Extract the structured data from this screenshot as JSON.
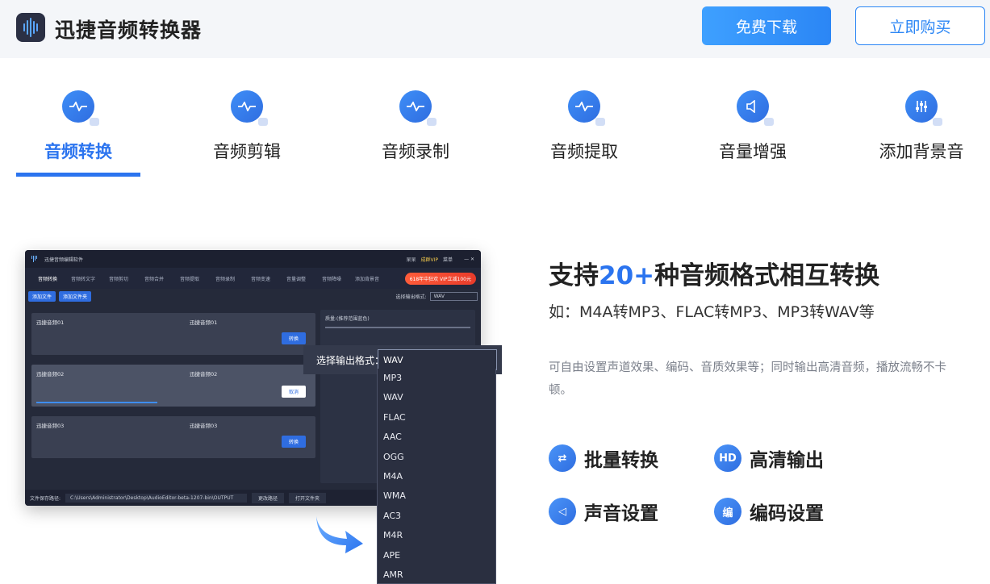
{
  "header": {
    "app_title": "迅捷音频转换器",
    "download_label": "免费下载",
    "buy_label": "立即购买"
  },
  "tabs": [
    {
      "label": "音频转换",
      "active": true
    },
    {
      "label": "音频剪辑",
      "active": false
    },
    {
      "label": "音频录制",
      "active": false
    },
    {
      "label": "音频提取",
      "active": false
    },
    {
      "label": "音量增强",
      "active": false
    },
    {
      "label": "添加背景音",
      "active": false
    }
  ],
  "screenshot": {
    "window_title": "迅捷音频编辑软件",
    "user_name": "呆呆",
    "vip_label": "成群VIP",
    "menu_label": "菜单",
    "tools": [
      "音频转换",
      "音频转文字",
      "音频剪切",
      "音频合并",
      "音频提取",
      "音频录制",
      "音频变速",
      "音量调整",
      "音频降噪",
      "添加背景音"
    ],
    "promo": "618年中狂欢 VIP立减100元",
    "add_file": "添加文件",
    "add_folder": "添加文件夹",
    "output_format_label": "选择输出格式:",
    "output_format_value": "WAV",
    "quality_label": "质量:(推荐范围蓝色)",
    "files": [
      {
        "name": "迅捷音频01",
        "target": "迅捷音频01",
        "action": "转换"
      },
      {
        "name": "迅捷音频02",
        "target": "迅捷音频02",
        "action": "取消"
      },
      {
        "name": "迅捷音频03",
        "target": "迅捷音频03",
        "action": "转换"
      }
    ],
    "save_path_label": "文件保存路径:",
    "save_path": "C:\\Users\\Administrator\\Desktop\\AudioEditor-beta-1207-bin\\OUTPUT",
    "change_path": "更改路径",
    "open_folder": "打开文件夹"
  },
  "format_dropdown": {
    "label": "选择输出格式：",
    "selected": "WAV",
    "options": [
      "MP3",
      "WAV",
      "FLAC",
      "AAC",
      "OGG",
      "M4A",
      "WMA",
      "AC3",
      "M4R",
      "APE",
      "AMR"
    ]
  },
  "content": {
    "headline_pre": "支持",
    "headline_num": "20+",
    "headline_post": "种音频格式相互转换",
    "subline": "如：M4A转MP3、FLAC转MP3、MP3转WAV等",
    "description": "可自由设置声道效果、编码、音质效果等；同时输出高清音频，播放流畅不卡顿。"
  },
  "features": [
    {
      "label": "批量转换",
      "icon": "batch-convert-icon",
      "glyph": "⇄"
    },
    {
      "label": "高清输出",
      "icon": "hd-icon",
      "glyph": "HD"
    },
    {
      "label": "声音设置",
      "icon": "speaker-icon",
      "glyph": "◁"
    },
    {
      "label": "编码设置",
      "icon": "encode-icon",
      "glyph": "编"
    }
  ],
  "colors": {
    "accent": "#2b74ef",
    "header_bg": "#f4f6f9"
  }
}
